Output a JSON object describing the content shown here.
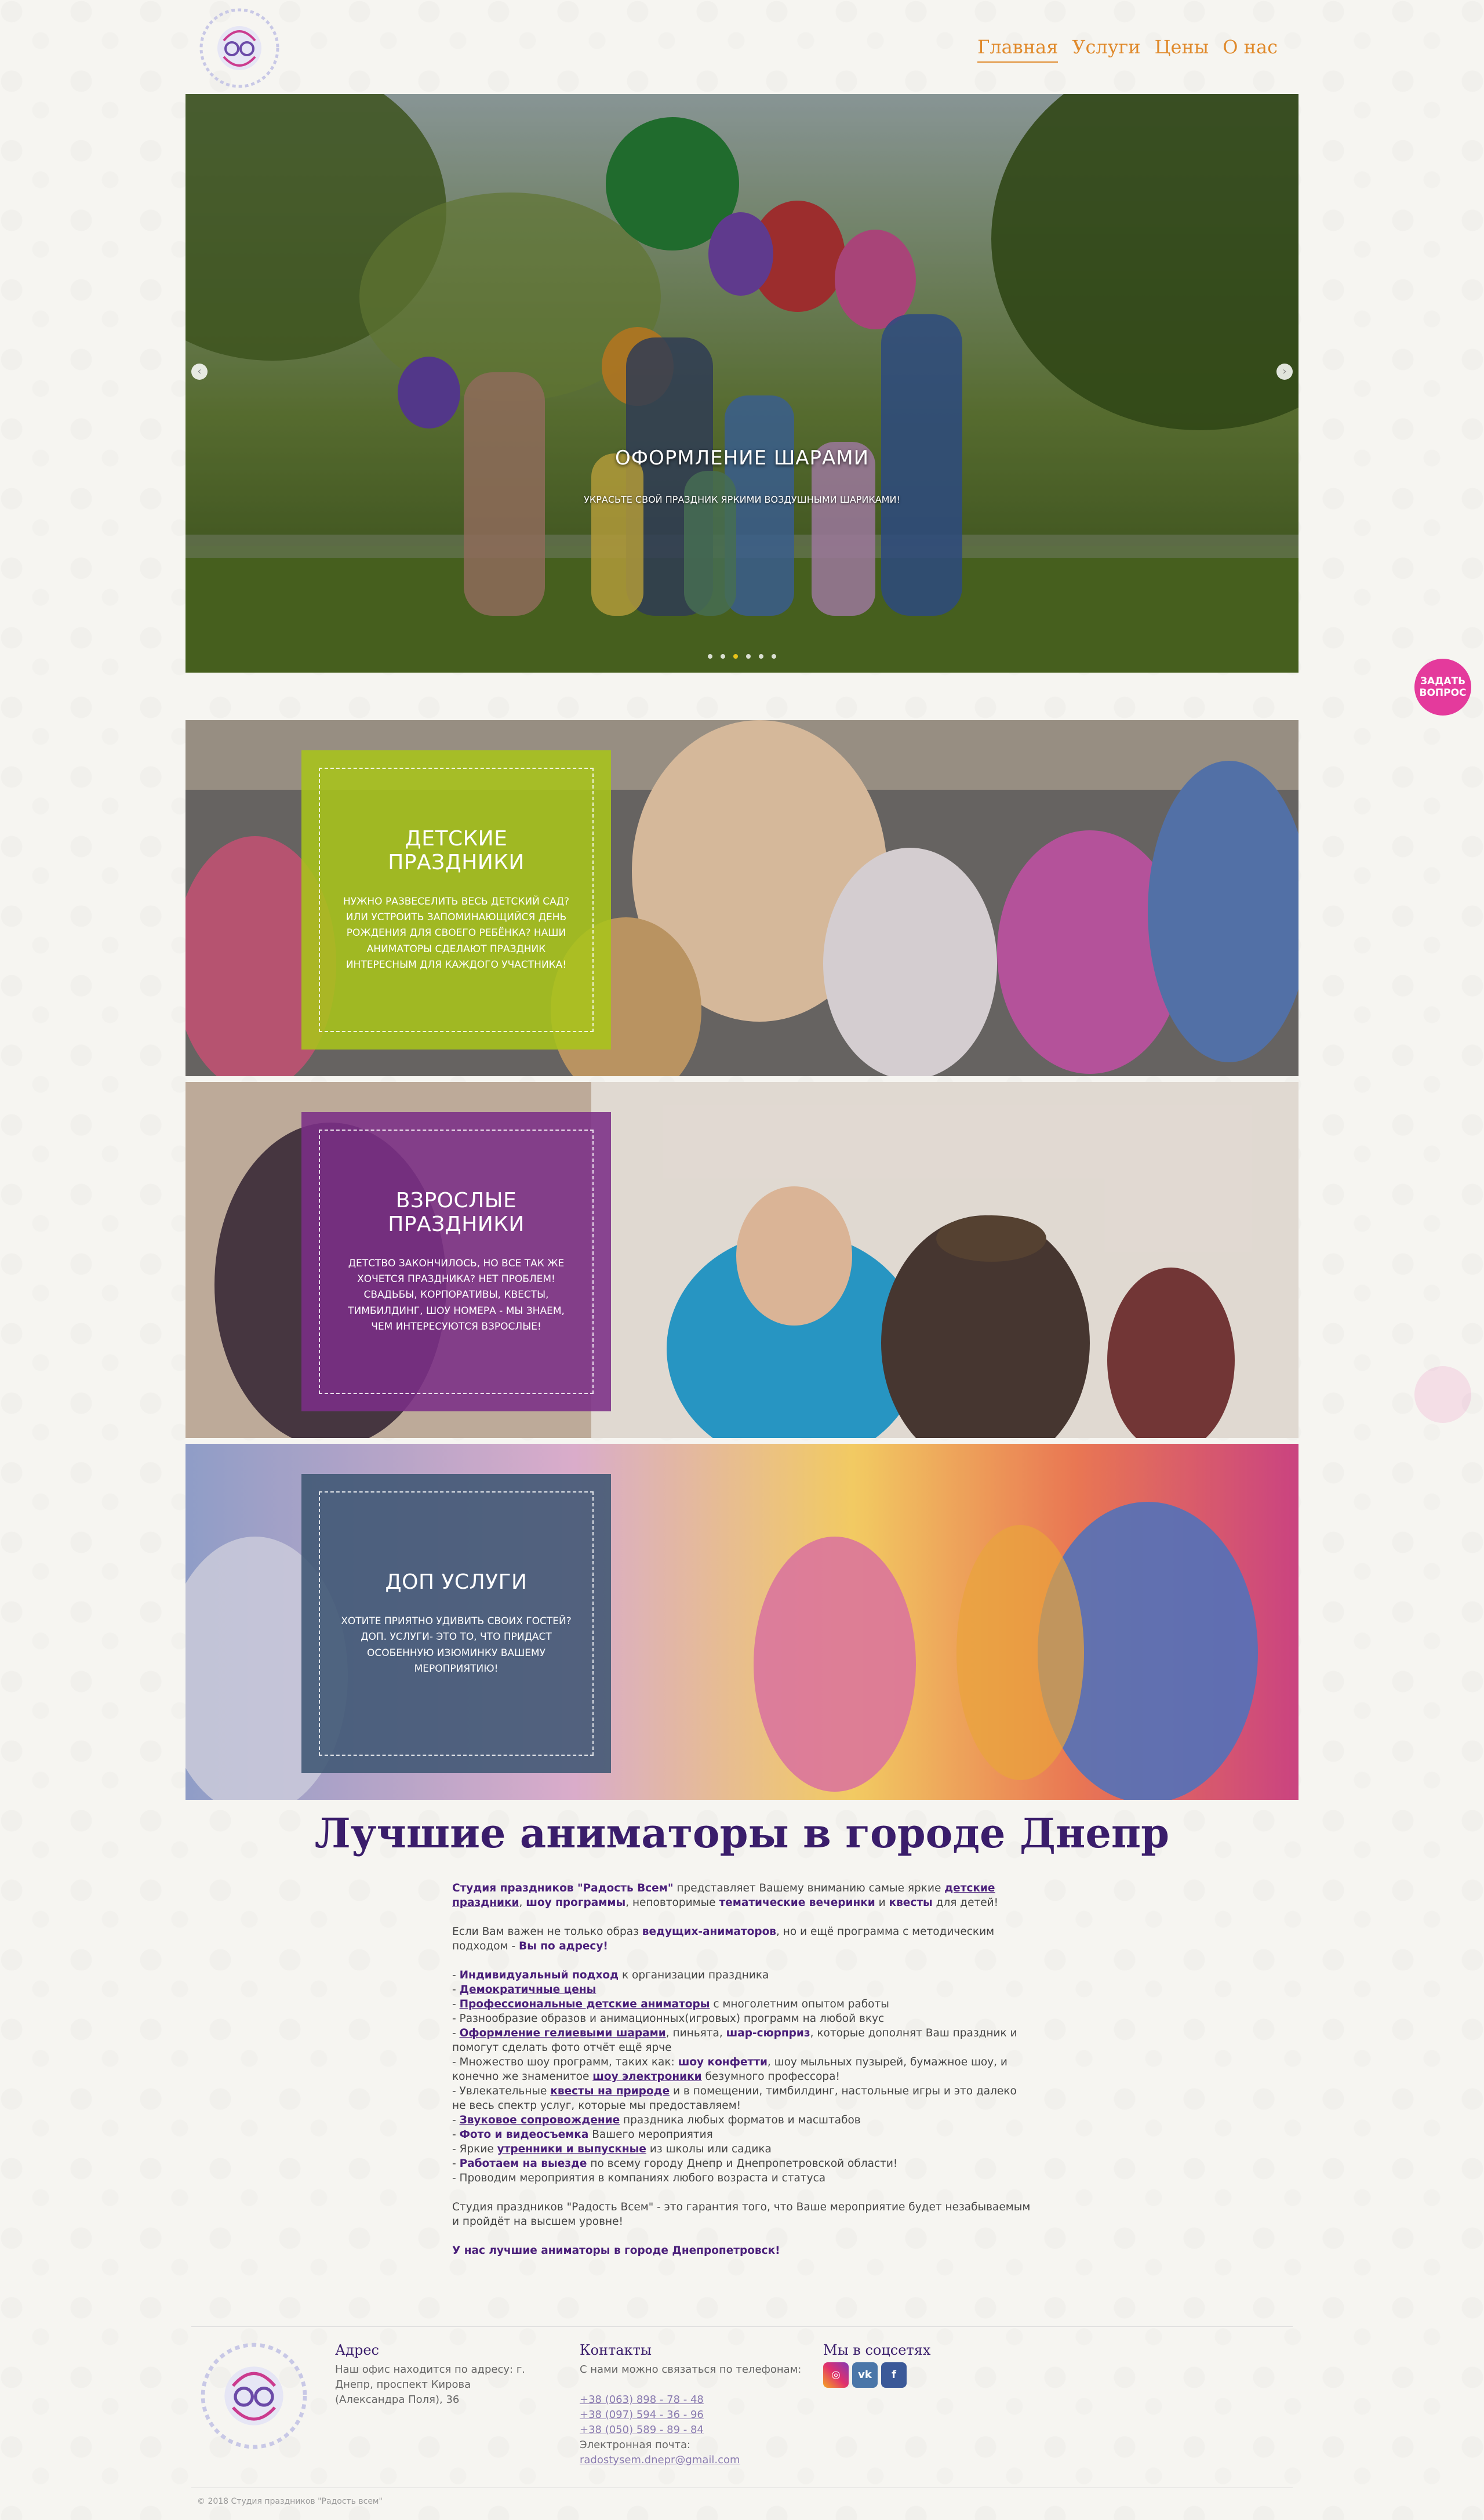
{
  "nav": {
    "items": [
      "Главная",
      "Услуги",
      "Цены",
      "О нас"
    ]
  },
  "slider": {
    "title": "ОФОРМЛЕНИЕ ШАРАМИ",
    "subtitle": "УКРАСЬТЕ СВОЙ ПРАЗДНИК ЯРКИМИ ВОЗДУШНЫМИ ШАРИКАМИ!",
    "dot_count": 6,
    "active_dot": 2
  },
  "ask_button": "ЗАДАТЬ ВОПРОС",
  "panels": [
    {
      "title": "ДЕТСКИЕ ПРАЗДНИКИ",
      "text": "НУЖНО РАЗВЕСЕЛИТЬ ВЕСЬ ДЕТСКИЙ САД? ИЛИ УСТРОИТЬ ЗАПОМИНАЮЩИЙСЯ ДЕНЬ РОЖДЕНИЯ ДЛЯ СВОЕГО РЕБЁНКА? НАШИ АНИМАТОРЫ СДЕЛАЮТ ПРАЗДНИК ИНТЕРЕСНЫМ ДЛЯ КАЖДОГО УЧАСТНИКА!"
    },
    {
      "title": "ВЗРОСЛЫЕ ПРАЗДНИКИ",
      "text": "ДЕТСТВО ЗАКОНЧИЛОСЬ, НО ВСЕ ТАК ЖЕ ХОЧЕТСЯ ПРАЗДНИКА? НЕТ ПРОБЛЕМ! СВАДЬБЫ, КОРПОРАТИВЫ, КВЕСТЫ, ТИМБИЛДИНГ, ШОУ НОМЕРА - МЫ ЗНАЕМ, ЧЕМ ИНТЕРЕСУЮТСЯ ВЗРОСЛЫЕ!"
    },
    {
      "title": "ДОП УСЛУГИ",
      "text": "ХОТИТЕ ПРИЯТНО УДИВИТЬ СВОИХ ГОСТЕЙ? ДОП. УСЛУГИ- ЭТО ТО, ЧТО ПРИДАСТ ОСОБЕННУЮ ИЗЮМИНКУ ВАШЕМУ МЕРОПРИЯТИЮ!"
    }
  ],
  "article": {
    "title": "Лучшие аниматоры в городе Днепр",
    "footer_line": "У нас лучшие аниматоры в городе Днепропетровск!"
  },
  "footer": {
    "address_title": "Адрес",
    "address_text": "Наш офис находится по адресу: г. Днепр, проспект Кирова (Александра Поля), 36",
    "contacts_title": "Контакты",
    "contacts_text": "С нами можно связаться по телефонам:",
    "phones": [
      "+38 (063) 898 - 78 - 48",
      "+38 (097) 594 - 36 - 96",
      "+38 (050) 589 - 89 - 84"
    ],
    "email_label": "Электронная почта:",
    "email": "radostysem.dnepr@gmail.com",
    "social_title": "Мы в соцсетях",
    "copyright": "© 2018 Студия праздников \"Радость всем\""
  },
  "colors": {
    "nav": "#e08a2c",
    "title": "#3a1d6b",
    "accent": "#e43a9c",
    "panel_green": "#a9c41a",
    "panel_purple": "#7b2f86",
    "panel_slate": "#3f5673"
  }
}
